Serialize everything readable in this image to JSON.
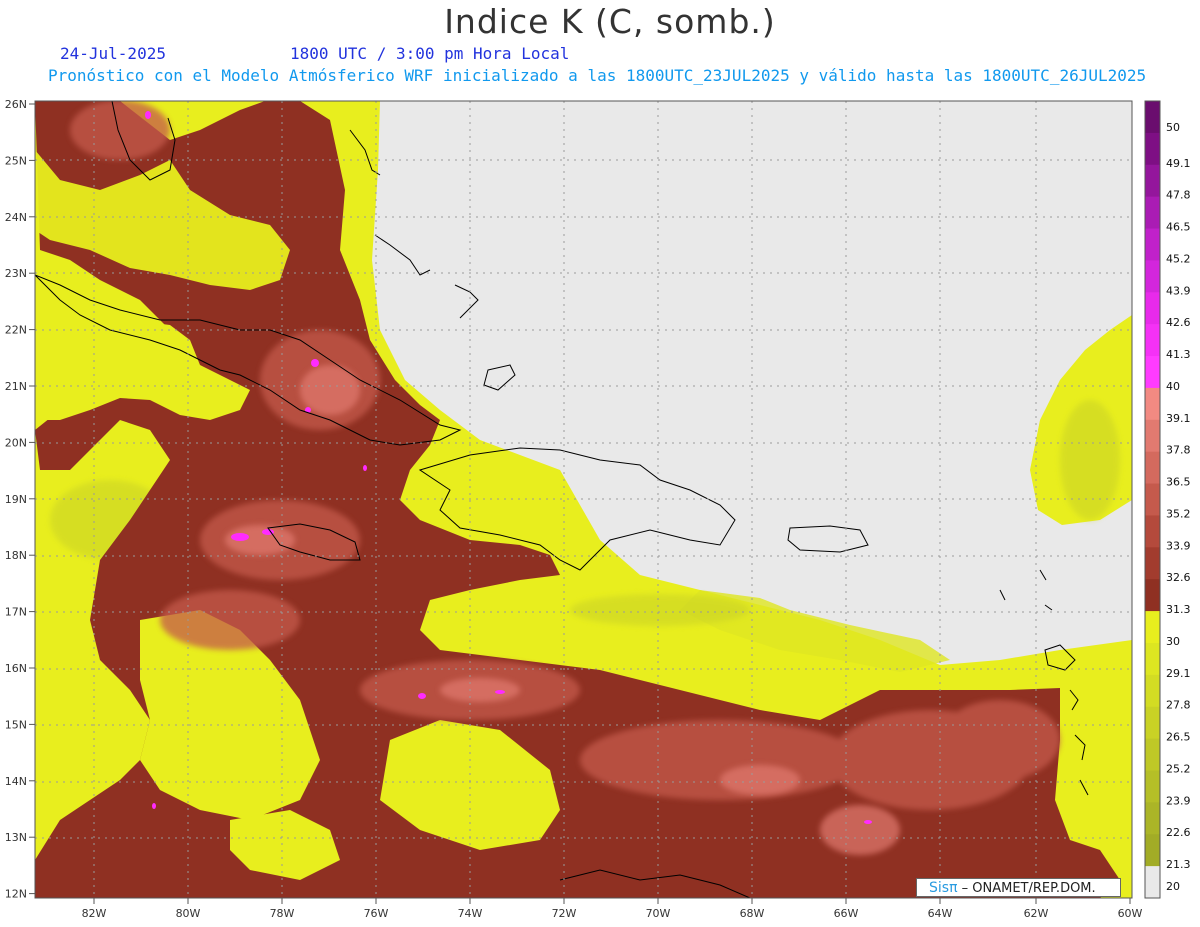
{
  "header": {
    "title": "Indice K (C, somb.)",
    "date": "24-Jul-2025",
    "utc_time": "1800 UTC / 3:00 pm Hora Local",
    "model_line": "Pronóstico con el Modelo Atmósferico WRF inicializado a las 1800UTC_23JUL2025 y válido hasta las  1800UTC_26JUL2025"
  },
  "axes": {
    "lat_labels": [
      "26N",
      "25N",
      "24N",
      "23N",
      "22N",
      "21N",
      "20N",
      "19N",
      "18N",
      "17N",
      "16N",
      "15N",
      "14N",
      "13N",
      "12N"
    ],
    "lon_labels": [
      "82W",
      "80W",
      "78W",
      "76W",
      "74W",
      "72W",
      "70W",
      "68W",
      "66W",
      "64W",
      "62W",
      "60W"
    ],
    "lat_range": [
      12,
      26
    ],
    "lon_range": [
      -83.2,
      -60
    ]
  },
  "colorbar": {
    "labels": [
      "50",
      "49.1",
      "47.8",
      "46.5",
      "45.2",
      "43.9",
      "42.6",
      "41.3",
      "40",
      "39.1",
      "37.8",
      "36.5",
      "35.2",
      "33.9",
      "32.6",
      "31.3",
      "30",
      "29.1",
      "27.8",
      "26.5",
      "25.2",
      "23.9",
      "22.6",
      "21.3",
      "20"
    ],
    "colors": [
      "#6a0d6e",
      "#7e0f84",
      "#94169c",
      "#aa1cb4",
      "#c021ca",
      "#d326dc",
      "#e82aeb",
      "#f531f6",
      "#ff3bff",
      "#f28a82",
      "#e27a70",
      "#d46a5e",
      "#c55a4c",
      "#b44a3c",
      "#a23c2e",
      "#8f3022",
      "#e8ee1e",
      "#dde621",
      "#d3dc23",
      "#c9d225",
      "#bfc826",
      "#b5bf27",
      "#abb527",
      "#a2ac26",
      "#e9e9e9"
    ]
  },
  "legend": {
    "brand": "Sisπ",
    "org": "– ONAMET/REP.DOM."
  },
  "palette": {
    "background": "#e9e9e9",
    "yellow": "#e8ee1e",
    "brown_dark": "#8f3022",
    "brown_mid": "#a84434",
    "pink": "#d97468",
    "magenta": "#ff2bff",
    "coast": "#000000"
  }
}
